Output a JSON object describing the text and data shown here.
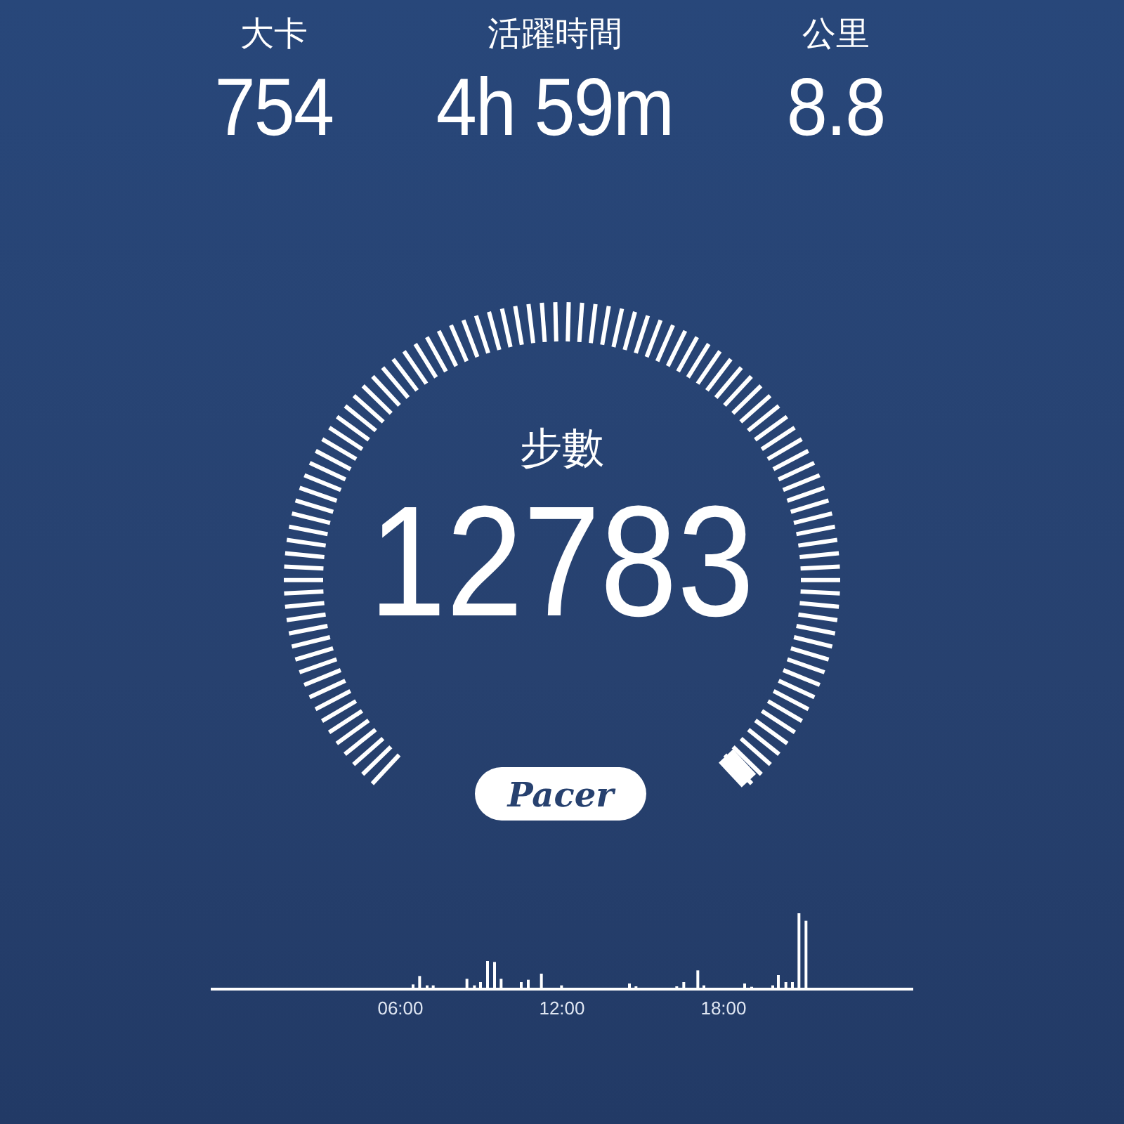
{
  "stats": [
    {
      "label": "大卡",
      "value": "754"
    },
    {
      "label": "活躍時間",
      "value": "4h 59m"
    },
    {
      "label": "公里",
      "value": "8.8"
    }
  ],
  "gauge": {
    "label": "步數",
    "value": "12783"
  },
  "logo": "Pacer",
  "activity_chart": {
    "x_labels": [
      "06:00",
      "12:00",
      "18:00"
    ]
  }
}
